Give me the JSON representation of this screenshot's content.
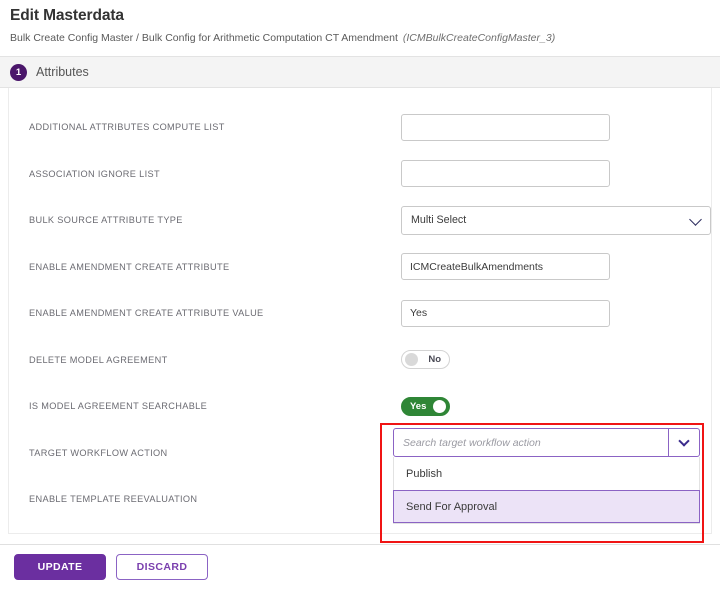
{
  "header": {
    "title": "Edit Masterdata",
    "breadcrumb": "Bulk Create Config Master / Bulk Config for Arithmetic Computation CT Amendment",
    "breadcrumb_code": "(ICMBulkCreateConfigMaster_3)"
  },
  "section": {
    "step_number": "1",
    "title": "Attributes"
  },
  "form": {
    "rows": [
      {
        "label": "ADDITIONAL ATTRIBUTES COMPUTE LIST",
        "type": "text",
        "value": "",
        "placeholder": ""
      },
      {
        "label": "ASSOCIATION IGNORE LIST",
        "type": "text",
        "value": "",
        "placeholder": ""
      },
      {
        "label": "BULK SOURCE ATTRIBUTE TYPE",
        "type": "select",
        "value": "Multi Select"
      },
      {
        "label": "ENABLE AMENDMENT CREATE ATTRIBUTE",
        "type": "text",
        "value": "ICMCreateBulkAmendments",
        "placeholder": ""
      },
      {
        "label": "ENABLE AMENDMENT CREATE ATTRIBUTE VALUE",
        "type": "text",
        "value": "Yes",
        "placeholder": ""
      },
      {
        "label": "DELETE MODEL AGREEMENT",
        "type": "toggle",
        "state": "off",
        "value": "No"
      },
      {
        "label": "IS MODEL AGREEMENT SEARCHABLE",
        "type": "toggle",
        "state": "on",
        "value": "Yes"
      },
      {
        "label": "TARGET WORKFLOW ACTION",
        "type": "searchdropdown"
      },
      {
        "label": "ENABLE TEMPLATE REEVALUATION",
        "type": "empty"
      }
    ]
  },
  "search_dropdown": {
    "placeholder": "Search target workflow action",
    "value": "",
    "options": [
      {
        "label": "Publish",
        "selected": false
      },
      {
        "label": "Send For Approval",
        "selected": true
      }
    ]
  },
  "footer": {
    "update_label": "UPDATE",
    "discard_label": "DISCARD"
  },
  "colors": {
    "brand_purple": "#6b2fa0",
    "step_badge": "#4b176b",
    "toggle_on_green": "#2f8636",
    "highlight_red": "#f01414",
    "option_selected_bg": "#ece3f7"
  }
}
